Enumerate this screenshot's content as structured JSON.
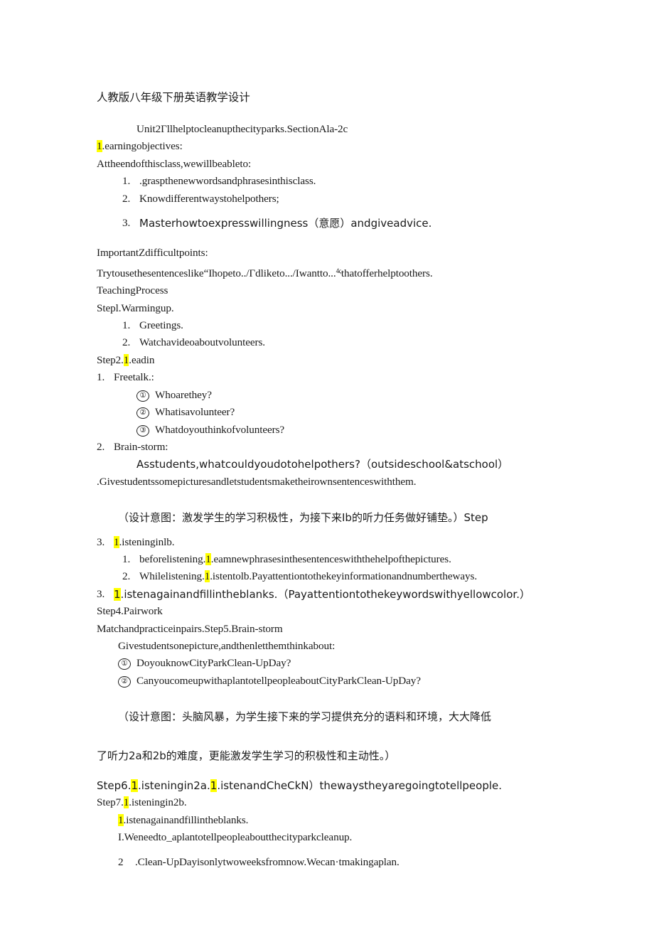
{
  "document": {
    "heading": "人教版八年级下册英语教学设计",
    "unit_line": "Unit2Γllhelptocleanupthecityparks.SectionAla-2c",
    "learning_objectives": {
      "label_hl": "1",
      "label_rest": ".earningobjectives:",
      "intro": "Attheendofthisclass,wewillbeableto:",
      "items": [
        {
          "num": "1.",
          "text": ".graspthenewwordsandphrasesinthisclass."
        },
        {
          "num": "2.",
          "text": "Knowdifferentwaystohelpothers;"
        },
        {
          "num": "3.",
          "text": "Masterhowtoexpresswillingness（意愿）andgiveadvice."
        }
      ]
    },
    "important_points": {
      "heading": "ImportantZdifficultpoints:",
      "body_before": "Trytousethesentenceslike“Ihopeto../Γdliketo.../Iwantto...",
      "body_sup": "4ς",
      "body_after": "thatofferhelptoothers."
    },
    "teaching_process": {
      "heading": "TeachingProcess",
      "step1": {
        "title": "Stepl.Warmingup.",
        "items": [
          {
            "num": "1.",
            "text": "Greetings."
          },
          {
            "num": "2.",
            "text": "Watchavideoaboutvolunteers."
          }
        ]
      },
      "step2": {
        "title_before": "Step2.",
        "title_hl": "1",
        "title_after": ".eadin",
        "free_talk": {
          "num": "1.",
          "label": "Freetalk.:",
          "questions": [
            {
              "marker": "①",
              "text": "Whoarethey?"
            },
            {
              "marker": "②",
              "text": "Whatisavolunteer?"
            },
            {
              "marker": "③",
              "text": "Whatdoyouthinkofvolunteers?"
            }
          ]
        },
        "brain_storm": {
          "num": "2.",
          "label": "Brain-storm:",
          "prompt": "Asstudents,whatcouldyoudotohelpothers?（outsideschool&atschool）",
          "note": ".Givestudentssomepicturesandletstudentsmaketheirownsentenceswiththem."
        }
      },
      "design_note_1": "（设计意图：激发学生的学习积极性，为接下来Ib的听力任务做好铺垫。）Step",
      "step3": {
        "num": "3.",
        "title_hl": "1",
        "title_after": ".isteninginlb.",
        "items": [
          {
            "num": "1.",
            "before": "beforelistening.",
            "hl": "1",
            "after": ".eamnewphrasesinthesentenceswiththehelpofthepictures."
          },
          {
            "num": "2.",
            "before": "Whilelistening.",
            "hl": "1",
            "after": ".istentolb.Payattentiontothekeyinformationandnumbertheways."
          }
        ],
        "final": {
          "num": "3.",
          "hl": "1",
          "after": ".istenagainandfillintheblanks.（Payattentiontothekeywordswithyellowcolor.）"
        }
      },
      "step4": {
        "title": "Step4.Pairwork",
        "body": "Matchandpracticeinpairs.Step5.Brain-storm",
        "prompt": "Givestudentsonepicture,andthenletthemthinkabout:",
        "questions": [
          {
            "marker": "①",
            "text": "DoyouknowCityParkClean-UpDay?"
          },
          {
            "marker": "②",
            "text": "CanyoucomeupwithaplantotellpeopleaboutCityParkClean-UpDay?"
          }
        ]
      },
      "design_note_2_line1": "（设计意图：头脑风暴，为学生接下来的学习提供充分的语料和环境，大大降低",
      "design_note_2_line2": "了听力2a和2b的难度，更能激发学生学习的积极性和主动性。）",
      "step6": {
        "before": "Step6.",
        "hl1": "1",
        "mid": ".isteningin2a.",
        "hl2": "1",
        "after": ".istenandCheCkN）thewaystheyaregoingtotellpeople."
      },
      "step7": {
        "before": "Step7.",
        "hl": "1",
        "after": ".isteningin2b.",
        "sub_hl": "1",
        "sub_after": ".istenagainandfillintheblanks.",
        "blanks": [
          {
            "num": "I.",
            "text": "Weneedto_aplantotellpeopleaboutthecityparkcleanup."
          },
          {
            "num": "2",
            "text": ".Clean-UpDayisonlytwoweeksfromnow.Wecan·tmakingaplan."
          }
        ]
      }
    }
  },
  "colors": {
    "highlight": "#ffff00",
    "text": "#1a1a1a",
    "page_background": "#ffffff"
  }
}
